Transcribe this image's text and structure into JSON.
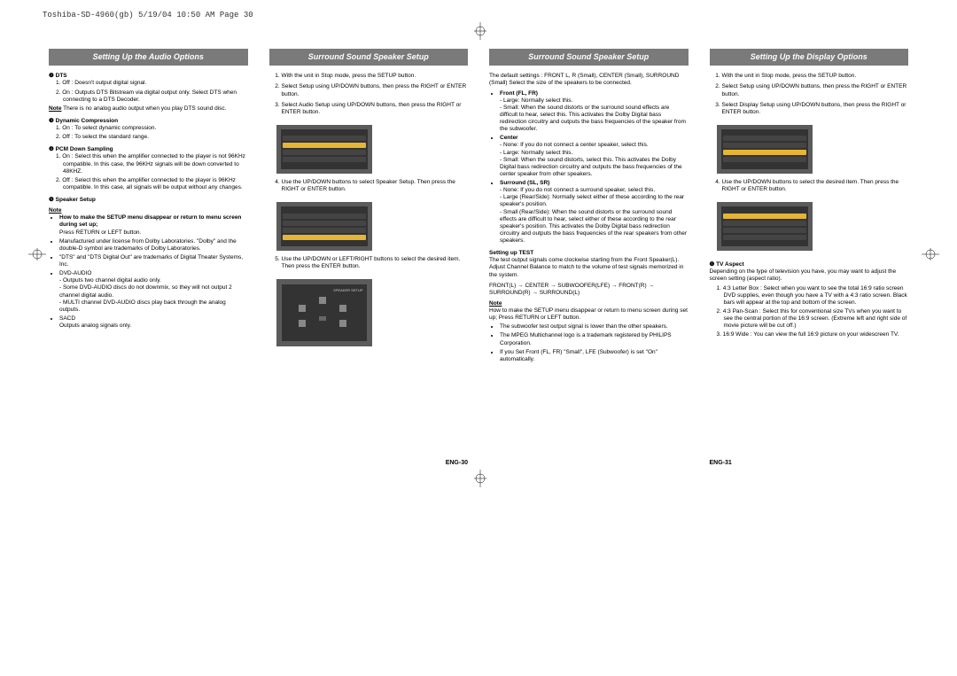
{
  "header_print": "Toshiba-SD-4960(gb)  5/19/04 10:50 AM  Page 30",
  "columns": {
    "c1": {
      "title": "Setting Up the Audio Options",
      "dts_label": "❷ DTS",
      "dts1": "1. Off : Doesn't output digital signal.",
      "dts2": "2. On : Outputs DTS Bitstream via digital output only. Select DTS when connecting to a DTS Decoder.",
      "dts_note_label": "Note",
      "dts_note": "There is no analog audio output when you play DTS sound disc.",
      "dc_label": "❸ Dynamic Compression",
      "dc1": "1. On : To select dynamic compression.",
      "dc2": "2. Off : To select the standard range.",
      "pcm_label": "❹ PCM Down Sampling",
      "pcm1": "1. On : Select this when the amplifier connected to the player is not 96KHz compatible. In this case, the 96KHz signals will be down converted to 48KHZ.",
      "pcm2": "2. Off : Select this when the amplifier connected to the player is 96KHz compatible. In this case, all signals will be output without any changes.",
      "ss_label": "❺ Speaker Setup",
      "note": "Note",
      "note_bullet1": "How to make the SETUP menu disappear or return to menu screen during set up;",
      "note_sub1": "Press RETURN or LEFT button.",
      "bul2": "Manufactured under license from Dolby Laboratories. \"Dolby\" and the double-D symbol are trademarks of Dolby Laboratories.",
      "bul3": "\"DTS\" and \"DTS Digital Out\" are trademarks of Digital Theater Systems, Inc.",
      "bul4": "DVD-AUDIO",
      "bul4a": "- Outputs two channel digital audio only.",
      "bul4b": "- Some DVD-AUDIO discs do not downmix, so they will not output 2 channel digital audio.",
      "bul4c": "- MULTI channel DVD-AUDIO discs play back through the analog outputs.",
      "bul5": "SACD",
      "bul5a": "Outputs analog signals only.",
      "pgno": "ENG-30"
    },
    "c2": {
      "title": "Surround Sound Speaker Setup",
      "s1": "With the unit in Stop mode, press the SETUP button.",
      "s2": "Select Setup using UP/DOWN buttons, then press the RIGHT or ENTER button.",
      "s3": "Select Audio Setup using UP/DOWN buttons, then press the RIGHT or ENTER button.",
      "s4": "Use the UP/DOWN buttons to select Speaker Setup. Then press the RIGHT or ENTER button.",
      "s5": "Use the UP/DOWN or LEFT/RIGHT buttons to select the desired item. Then press the ENTER button."
    },
    "c3": {
      "title": "Surround Sound Speaker Setup",
      "intro": "The default settings : FRONT L, R (Small), CENTER (Small), SURROUND (Small) Select the size of the speakers to be connected.",
      "front_label": "Front (FL, FR)",
      "front1": "- Large: Normally select this.",
      "front2": "- Small: When the sound distorts or the surround sound effects are difficult to hear, select this. This activates the Dolby Digital bass redirection circuitry and outputs the bass frequencies of the speaker from the subwoofer.",
      "center_label": "Center",
      "center1": "- None: If you do not connect a center speaker, select this.",
      "center2": "- Large: Normally select this.",
      "center3": "- Small: When the sound distorts, select this. This activates the Dolby Digital bass redirection circuitry and outputs the bass frequencies of the center speaker from other speakers.",
      "surr_label": "Surround (SL, SR)",
      "surr1": "- None: If you do not connect a surround speaker, select this.",
      "surr2": "- Large (Rear/Side): Normally select either of these according to the rear speaker's position.",
      "surr3": "- Small (Rear/Side): When the sound distorts or the surround sound effects are difficult to hear, select either of these according to the rear speaker's position. This activates the Dolby Digital bass redirection circuitry and outputs the bass frequencies of the rear speakers from other speakers.",
      "test_label": "Setting up TEST",
      "test1": "The test output signals come clockwise starting from the Front Speaker(L). Adjust Channel Balance to match to the volume of test signals memorized in the system.",
      "test2": "FRONT(L) → CENTER → SUBWOOFER(LFE) → FRONT(R) → SURROUND(R) → SURROUND(L)",
      "note": "Note",
      "n1": "How to make the SETUP menu disappear or return to menu screen during set up; Press RETURN or LEFT button.",
      "n2": "The subwoofer test output signal is lower than the other speakers.",
      "n3": "The MPEG Multichannel logo is a trademark registered by PHILIPS Corporation.",
      "n4": "If you Set Front (FL, FR) \"Small\", LFE (Subwoofer) is set \"On\" automatically.",
      "pgno": "ENG-31"
    },
    "c4": {
      "title": "Setting Up the Display Options",
      "s1": "With the unit in Stop mode, press the SETUP button.",
      "s2": "Select Setup using UP/DOWN buttons, then press the RIGHT or ENTER button.",
      "s3": "Select Display Setup using UP/DOWN buttons, then press the RIGHT or ENTER button.",
      "s4": "Use the UP/DOWN buttons to select the desired item. Then press the RIGHT or ENTER button.",
      "tv_label": "❶ TV Aspect",
      "tv_intro": "Depending on the type of television you have, you may want to adjust the screen setting (aspect ratio).",
      "tv1": "1. 4:3 Letter Box : Select when you want to see the total 16:9 ratio screen DVD supplies, even though you have a TV with a 4:3 ratio screen. Black bars will appear at the top and bottom of the screen.",
      "tv2": "2. 4:3 Pan-Scan : Select this for conventional size TVs when you want to see the central portion of the 16:9 screen. (Extreme left and right side of movie picture will be cut off.)",
      "tv3": "3. 16:9 Wide : You can view the full 16:9 picture on your widescreen TV."
    }
  }
}
